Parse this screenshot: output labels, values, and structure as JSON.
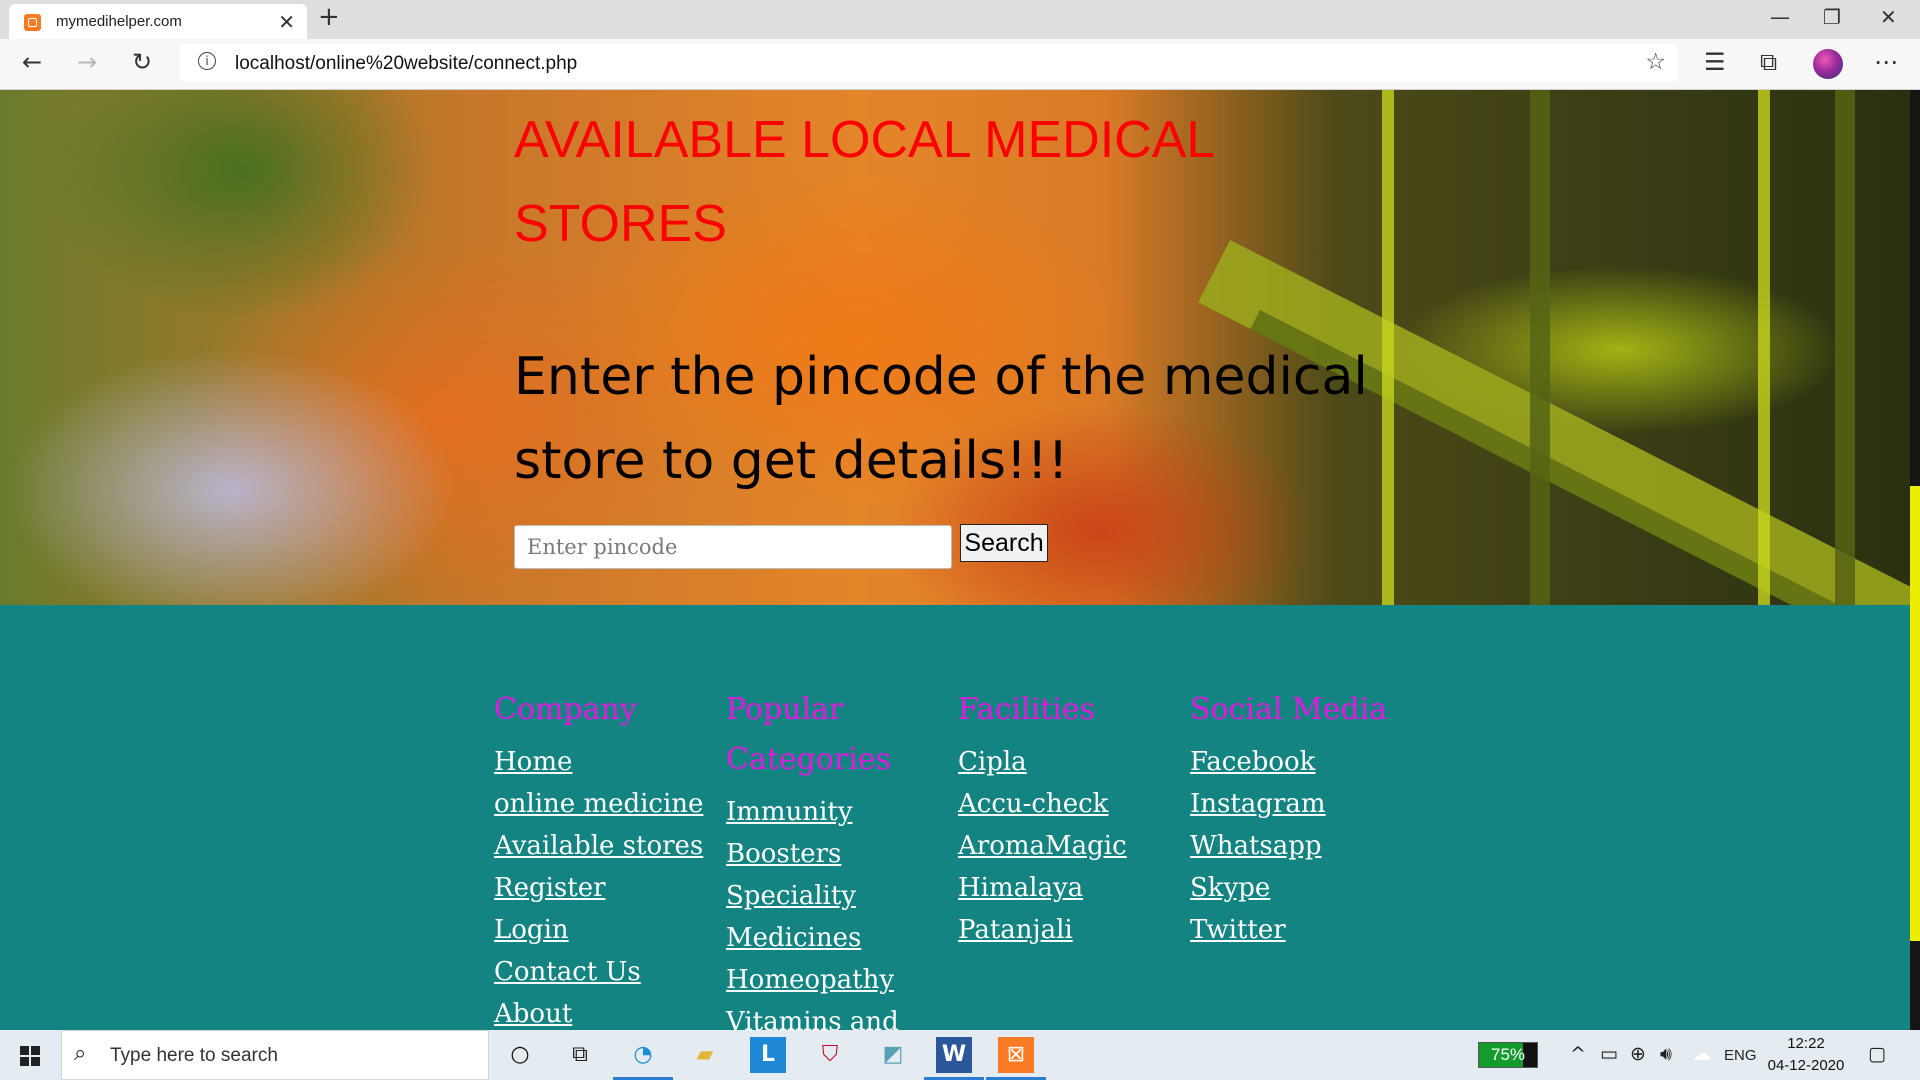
{
  "browser": {
    "tab_title": "mymedihelper.com",
    "tab_close": "✕",
    "new_tab": "+",
    "url": "localhost/online%20website/connect.php",
    "window_controls": {
      "minimize": "—",
      "restore": "❐",
      "close": "✕"
    }
  },
  "hero": {
    "title": "AVAILABLE LOCAL MEDICAL STORES",
    "subtitle": "Enter the pincode of the medical store to get details!!!",
    "input_placeholder": "Enter pincode",
    "search_label": "Search"
  },
  "footer": {
    "columns": [
      {
        "heading": "Company",
        "links": [
          "Home",
          "online medicine",
          "Available stores",
          "Register",
          "Login",
          "Contact Us",
          "About"
        ]
      },
      {
        "heading": "Popular Categories",
        "links": [
          "Immunity",
          "Boosters",
          "Speciality",
          "Medicines",
          "Homeopathy",
          "Vitamins and"
        ]
      },
      {
        "heading": "Facilities",
        "links": [
          "Cipla",
          "Accu-check",
          "AromaMagic",
          "Himalaya",
          "Patanjali"
        ]
      },
      {
        "heading": "Social Media",
        "links": [
          "Facebook",
          "Instagram",
          "Whatsapp",
          "Skype",
          "Twitter"
        ]
      }
    ]
  },
  "taskbar": {
    "search_placeholder": "Type here to search",
    "battery_percent": 75,
    "battery_label": "75%",
    "language": "ENG",
    "time": "12:22",
    "date": "04-12-2020"
  },
  "colors": {
    "hero_title": "#ff0000",
    "footer_bg": "#148483",
    "footer_heading": "#e21ae0",
    "footer_link": "#ffffff",
    "scroll_thumb": "#ecec00"
  }
}
